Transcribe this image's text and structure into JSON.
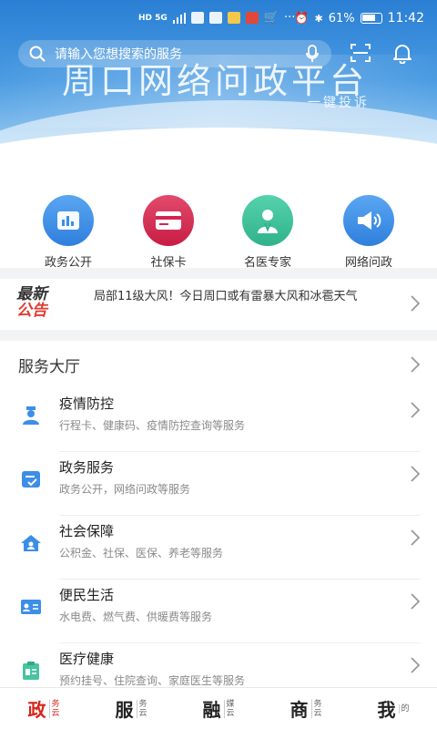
{
  "status_bar": {
    "network": "HD 5G",
    "battery": "61%",
    "time": "11:42"
  },
  "search": {
    "placeholder": "请输入您想搜索的服务"
  },
  "banner": {
    "title": "周口网络问政平台",
    "subtitle": "一键投诉"
  },
  "quick": [
    {
      "label": "政务公开",
      "color": "#3c8ee6",
      "icon": "chart-icon"
    },
    {
      "label": "社保卡",
      "color": "#d3264f",
      "icon": "card-icon"
    },
    {
      "label": "名医专家",
      "color": "#3dbf9a",
      "icon": "doctor-icon"
    },
    {
      "label": "网络问政",
      "color": "#3c8ee6",
      "icon": "megaphone-icon"
    }
  ],
  "notice": {
    "logo_line1": "最新",
    "logo_line2": "公告",
    "text": "局部11级大风！今日周口或有雷暴大风和冰雹天气"
  },
  "hall": {
    "title": "服务大厅",
    "items": [
      {
        "title": "疫情防控",
        "desc": "行程卡、健康码、疫情防控查询等服务",
        "icon": "health-worker-icon"
      },
      {
        "title": "政务服务",
        "desc": "政务公开，网络问政等服务",
        "icon": "document-check-icon"
      },
      {
        "title": "社会保障",
        "desc": "公积金、社保、医保、养老等服务",
        "icon": "house-person-icon"
      },
      {
        "title": "便民生活",
        "desc": "水电费、燃气费、供暖费等服务",
        "icon": "id-card-icon"
      },
      {
        "title": "医疗健康",
        "desc": "预约挂号、住院查询、家庭医生等服务",
        "icon": "medical-record-icon"
      }
    ]
  },
  "nav": [
    {
      "big": "政",
      "small": "务云",
      "active": true
    },
    {
      "big": "服",
      "small": "务云",
      "active": false
    },
    {
      "big": "融",
      "small": "媒云",
      "active": false
    },
    {
      "big": "商",
      "small": "务云",
      "active": false
    },
    {
      "big": "我",
      "small": "的",
      "active": false
    }
  ],
  "colors": {
    "primary": "#3c8ee6",
    "accent_red": "#d6261d"
  }
}
